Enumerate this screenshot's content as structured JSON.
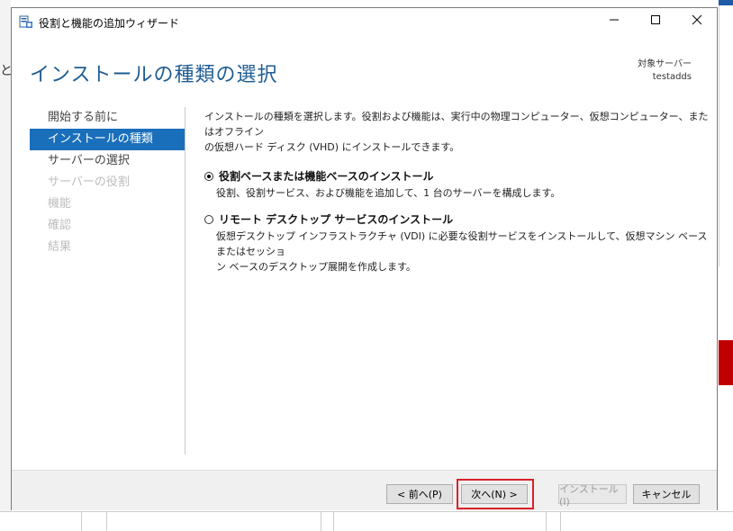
{
  "window": {
    "title": "役割と機能の追加ウィザード",
    "controls": {
      "minimize": "—",
      "maximize": "☐",
      "close": "✕"
    }
  },
  "header": {
    "title": "インストールの種類の選択",
    "destination_label": "対象サーバー",
    "destination_server": "testadds"
  },
  "nav": {
    "items": [
      {
        "label": "開始する前に",
        "state": "normal"
      },
      {
        "label": "インストールの種類",
        "state": "active"
      },
      {
        "label": "サーバーの選択",
        "state": "normal"
      },
      {
        "label": "サーバーの役割",
        "state": "disabled"
      },
      {
        "label": "機能",
        "state": "disabled"
      },
      {
        "label": "確認",
        "state": "disabled"
      },
      {
        "label": "結果",
        "state": "disabled"
      }
    ]
  },
  "content": {
    "intro_line1": "インストールの種類を選択します。役割および機能は、実行中の物理コンピューター、仮想コンピューター、またはオフライン",
    "intro_line2": "の仮想ハード ディスク (VHD) にインストールできます。",
    "options": [
      {
        "label": "役割ベースまたは機能ベースのインストール",
        "desc_line1": "役割、役割サービス、および機能を追加して、1 台のサーバーを構成します。",
        "desc_line2": "",
        "selected": true
      },
      {
        "label": "リモート デスクトップ サービスのインストール",
        "desc_line1": "仮想デスクトップ インフラストラクチャ (VDI) に必要な役割サービスをインストールして、仮想マシン ベースまたはセッショ",
        "desc_line2": "ン ベースのデスクトップ展開を作成します。",
        "selected": false
      }
    ]
  },
  "footer": {
    "prev": "< 前へ(P)",
    "next": "次へ(N) >",
    "install": "インストール(I)",
    "cancel": "キャンセル"
  },
  "background": {
    "left_char": "と"
  },
  "colors": {
    "accent": "#1a6fbb",
    "title": "#1f5d93",
    "highlight": "#d9222a"
  }
}
